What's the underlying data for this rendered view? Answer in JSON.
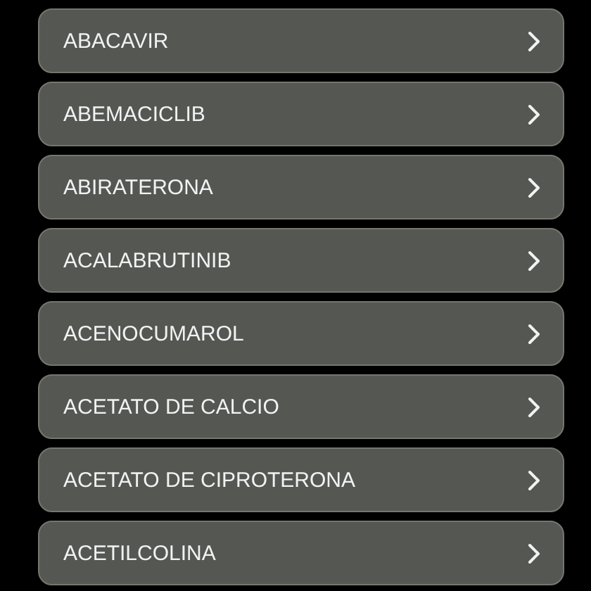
{
  "items": [
    {
      "label": "ABACAVIR"
    },
    {
      "label": "ABEMACICLIB"
    },
    {
      "label": "ABIRATERONA"
    },
    {
      "label": "ACALABRUTINIB"
    },
    {
      "label": "ACENOCUMAROL"
    },
    {
      "label": "ACETATO DE CALCIO"
    },
    {
      "label": "ACETATO DE CIPROTERONA"
    },
    {
      "label": "ACETILCOLINA"
    }
  ]
}
